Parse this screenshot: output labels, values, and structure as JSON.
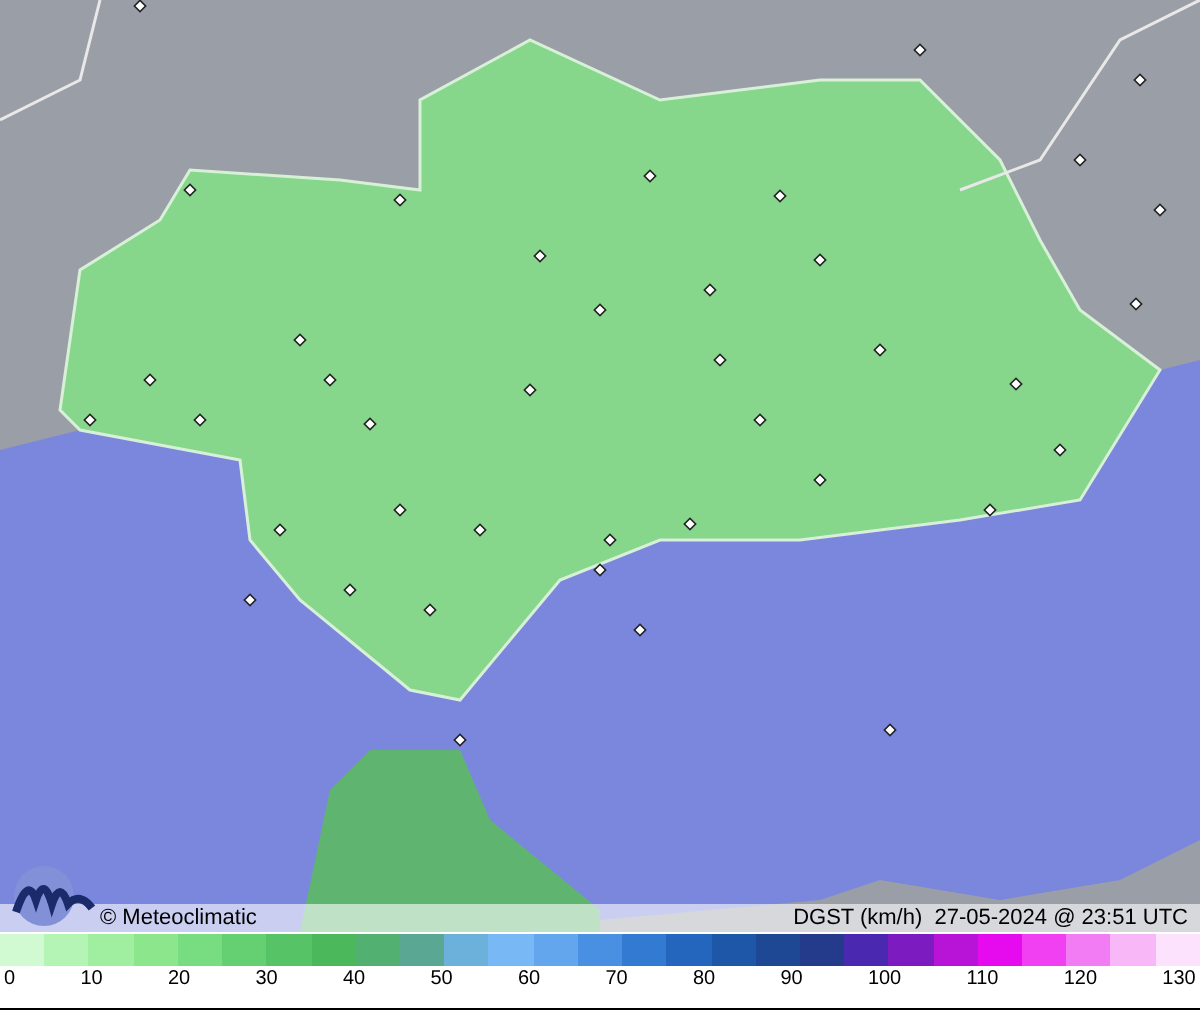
{
  "credit": "© Meteoclimatic",
  "caption": "DGST (km/h)  27-05-2024 @ 23:51 UTC",
  "legend": {
    "swatches": [
      {
        "color": "#d2fad2"
      },
      {
        "color": "#b4f4b4"
      },
      {
        "color": "#a0eea0"
      },
      {
        "color": "#8ce68c"
      },
      {
        "color": "#78dc80"
      },
      {
        "color": "#64d072"
      },
      {
        "color": "#56c466"
      },
      {
        "color": "#4cb85c"
      },
      {
        "color": "#52b070"
      },
      {
        "color": "#5aa894"
      },
      {
        "color": "#6cb0dc"
      },
      {
        "color": "#78b8f4"
      },
      {
        "color": "#64a6ee"
      },
      {
        "color": "#4a90e2"
      },
      {
        "color": "#327ad2"
      },
      {
        "color": "#2466be"
      },
      {
        "color": "#1e56a8"
      },
      {
        "color": "#1e4894"
      },
      {
        "color": "#243a8a"
      },
      {
        "color": "#4a28b0"
      },
      {
        "color": "#7c1cc0"
      },
      {
        "color": "#b814d8"
      },
      {
        "color": "#e60aee"
      },
      {
        "color": "#f040f2"
      },
      {
        "color": "#f27cf4"
      },
      {
        "color": "#f8b8f8"
      },
      {
        "color": "#fde2fd"
      }
    ],
    "ticks": [
      "0",
      "10",
      "20",
      "30",
      "40",
      "50",
      "60",
      "70",
      "80",
      "90",
      "100",
      "110",
      "120",
      "130"
    ]
  }
}
